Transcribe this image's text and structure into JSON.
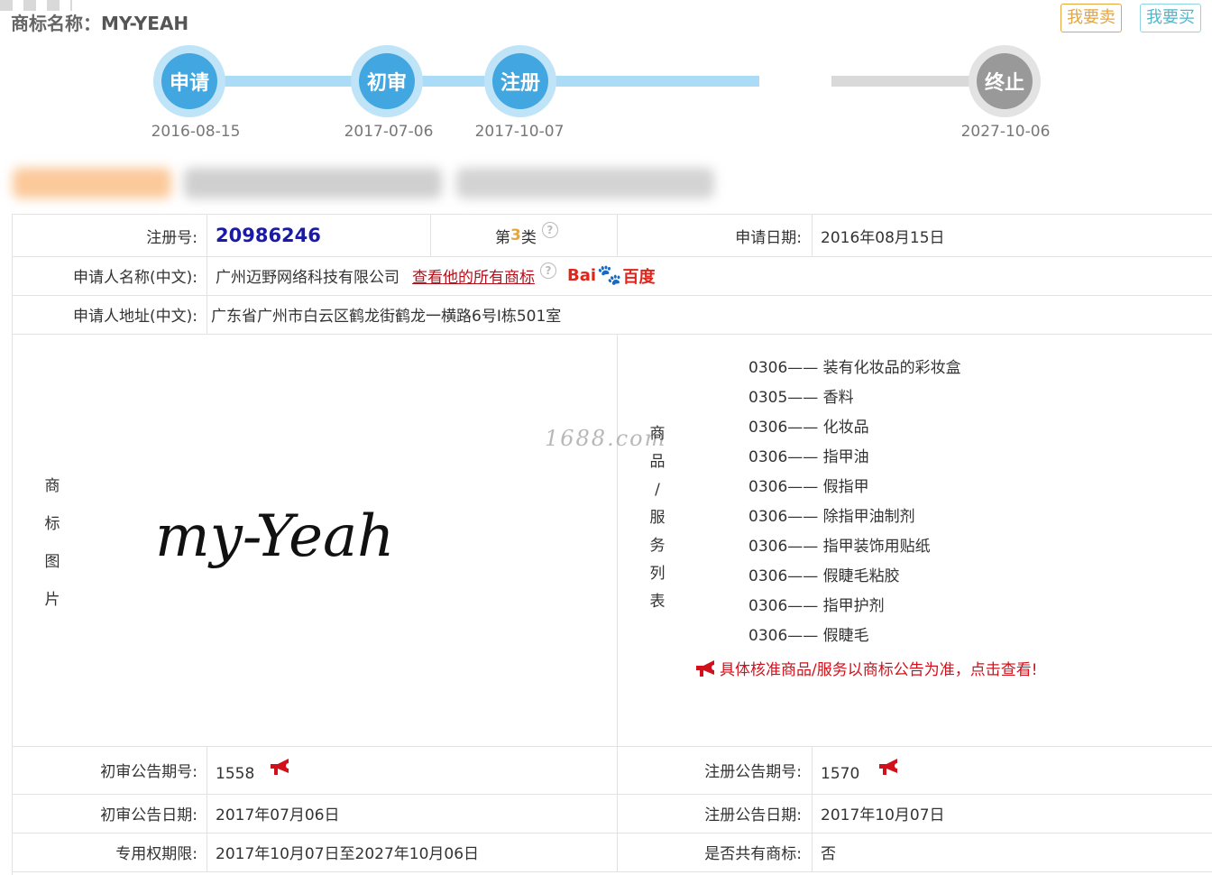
{
  "header": {
    "title_prefix": "商标名称：",
    "title_name": "MY-YEAH",
    "sell_label": "我要卖",
    "buy_label": "我要买"
  },
  "timeline": [
    {
      "label": "申请",
      "date": "2016-08-15",
      "state": "done"
    },
    {
      "label": "初审",
      "date": "2017-07-06",
      "state": "done"
    },
    {
      "label": "注册",
      "date": "2017-10-07",
      "state": "done"
    },
    {
      "label": "终止",
      "date": "2027-10-06",
      "state": "future"
    }
  ],
  "info": {
    "reg_no_label": "注册号:",
    "reg_no": "20986246",
    "class_pre": "第",
    "class_num": "3",
    "class_post": "类",
    "apply_date_label": "申请日期:",
    "apply_date": "2016年08月15日",
    "applicant_label": "申请人名称(中文):",
    "applicant": "广州迈野网络科技有限公司",
    "applicant_link": "查看他的所有商标",
    "baidu_a": "Bai",
    "baidu_b": "百度",
    "address_label": "申请人地址(中文):",
    "address": "广东省广州市白云区鹤龙街鹤龙一横路6号I栋501室",
    "image_label": [
      "商",
      "标",
      "图",
      "片"
    ],
    "logo_text": "my-Yeah",
    "watermark": "1688.com",
    "goods_label": [
      "商",
      "品",
      "/",
      "服",
      "务",
      "列",
      "表"
    ],
    "goods": [
      "0306—— 装有化妆品的彩妆盒",
      "0305—— 香料",
      "0306—— 化妆品",
      "0306—— 指甲油",
      "0306—— 假指甲",
      "0306—— 除指甲油制剂",
      "0306—— 指甲装饰用贴纸",
      "0306—— 假睫毛粘胶",
      "0306—— 指甲护剂",
      "0306—— 假睫毛"
    ],
    "goods_notice": "具体核准商品/服务以商标公告为准，点击查看!",
    "prelim_no_label": "初审公告期号:",
    "prelim_no": "1558",
    "reg_pub_no_label": "注册公告期号:",
    "reg_pub_no": "1570",
    "prelim_date_label": "初审公告日期:",
    "prelim_date": "2017年07月06日",
    "reg_pub_date_label": "注册公告日期:",
    "reg_pub_date": "2017年10月07日",
    "term_label": "专用权期限:",
    "term": "2017年10月07日至2027年10月06日",
    "shared_label": "是否共有商标:",
    "shared": "否"
  },
  "colors": {
    "accent_blue": "#42a7e0",
    "link_red": "#b3121d",
    "notice_red": "#d0111b",
    "class_orange": "#e5a63c"
  }
}
